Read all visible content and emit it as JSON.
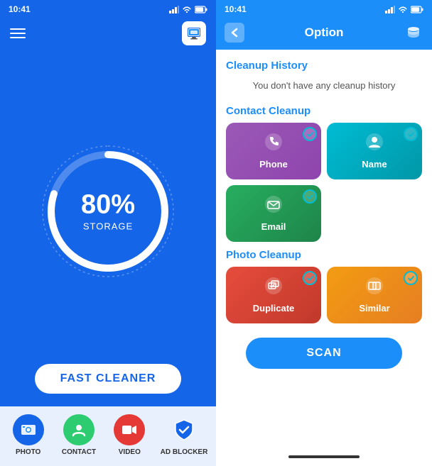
{
  "left": {
    "status_time": "10:41",
    "storage_percent": "80%",
    "storage_label": "STORAGE",
    "fast_cleaner_label": "FAST CLEANER",
    "nav": [
      {
        "id": "photo",
        "label": "PHOTO",
        "icon": "photo-icon"
      },
      {
        "id": "contact",
        "label": "CONTACT",
        "icon": "contact-icon"
      },
      {
        "id": "video",
        "label": "VIDEO",
        "icon": "video-icon"
      },
      {
        "id": "adblocker",
        "label": "AD BLOCKER",
        "icon": "check-icon"
      }
    ]
  },
  "right": {
    "status_time": "10:41",
    "title": "Option",
    "sections": {
      "cleanup_history_title": "Cleanup History",
      "cleanup_history_empty": "You don't have any cleanup history",
      "contact_cleanup_title": "Contact Cleanup",
      "photo_cleanup_title": "Photo Cleanup"
    },
    "contact_cards": [
      {
        "id": "phone",
        "label": "Phone"
      },
      {
        "id": "name",
        "label": "Name"
      }
    ],
    "contact_cards_row2": [
      {
        "id": "email",
        "label": "Email"
      }
    ],
    "photo_cards": [
      {
        "id": "duplicate",
        "label": "Duplicate"
      },
      {
        "id": "similar",
        "label": "Similar"
      }
    ],
    "scan_label": "SCAN"
  }
}
